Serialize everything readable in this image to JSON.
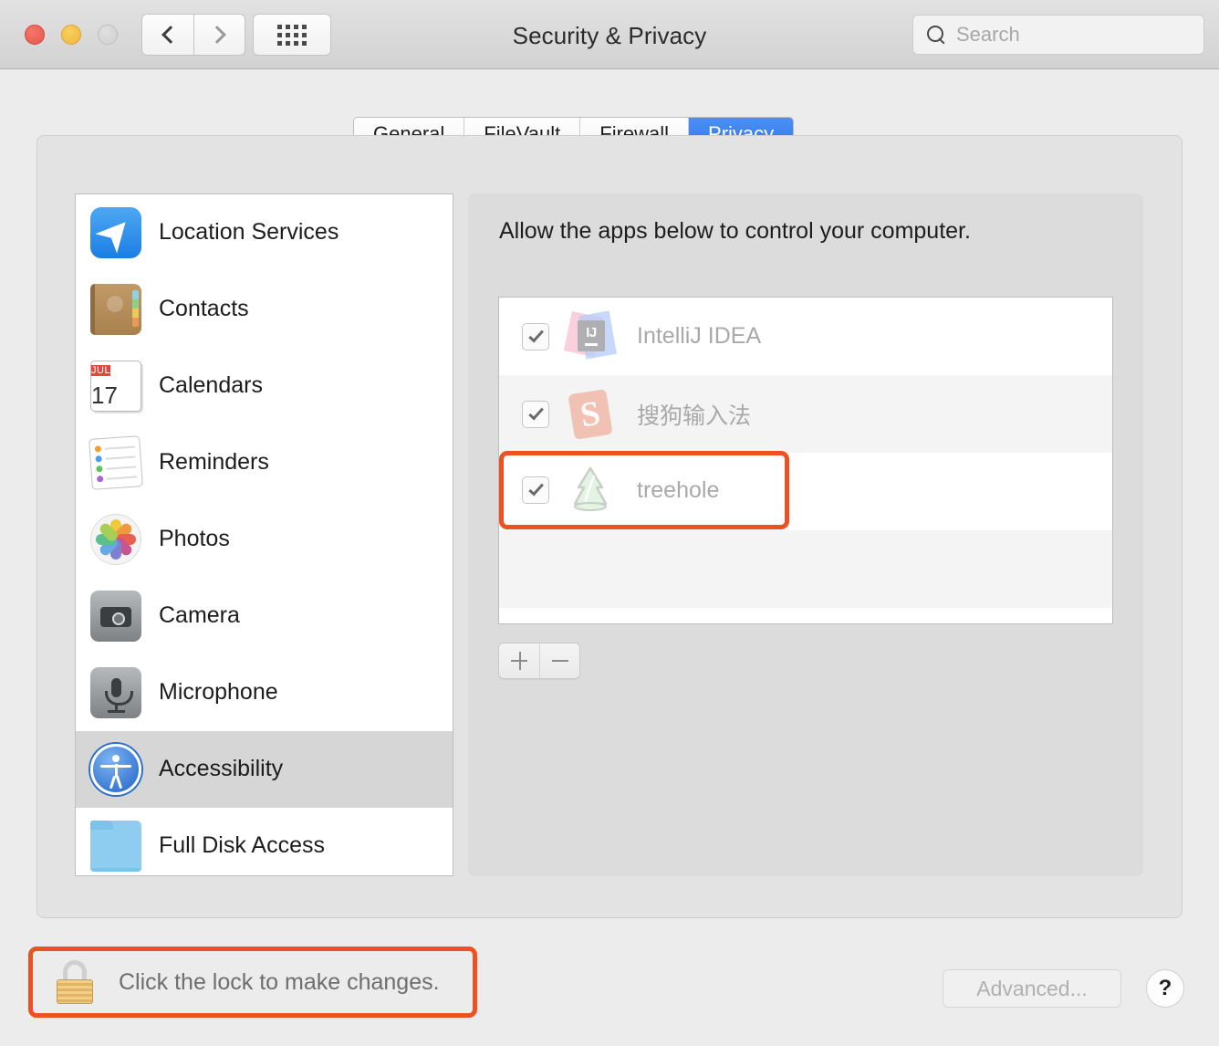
{
  "window": {
    "title": "Security & Privacy",
    "traffic_lights": [
      "close",
      "minimize",
      "zoom"
    ]
  },
  "toolbar": {
    "back_icon": "chevron-left-icon",
    "forward_icon": "chevron-right-icon",
    "show_all_icon": "grid-icon",
    "search": {
      "placeholder": "Search",
      "value": "",
      "icon": "search-icon"
    }
  },
  "tabs": [
    {
      "label": "General",
      "active": false
    },
    {
      "label": "FileVault",
      "active": false
    },
    {
      "label": "Firewall",
      "active": false
    },
    {
      "label": "Privacy",
      "active": true
    }
  ],
  "sidebar": {
    "items": [
      {
        "label": "Location Services",
        "icon": "location-services-icon",
        "selected": false
      },
      {
        "label": "Contacts",
        "icon": "contacts-icon",
        "selected": false
      },
      {
        "label": "Calendars",
        "icon": "calendar-icon",
        "selected": false,
        "calendar_month": "JUL",
        "calendar_day": "17"
      },
      {
        "label": "Reminders",
        "icon": "reminders-icon",
        "selected": false
      },
      {
        "label": "Photos",
        "icon": "photos-icon",
        "selected": false
      },
      {
        "label": "Camera",
        "icon": "camera-icon",
        "selected": false
      },
      {
        "label": "Microphone",
        "icon": "microphone-icon",
        "selected": false
      },
      {
        "label": "Accessibility",
        "icon": "accessibility-icon",
        "selected": true
      },
      {
        "label": "Full Disk Access",
        "icon": "folder-icon",
        "selected": false
      }
    ]
  },
  "main": {
    "description": "Allow the apps below to control your computer.",
    "apps": [
      {
        "name": "IntelliJ IDEA",
        "icon": "intellij-idea-icon",
        "checked": true,
        "highlighted": false
      },
      {
        "name": "搜狗输入法",
        "icon": "sogou-input-icon",
        "checked": true,
        "highlighted": false
      },
      {
        "name": "treehole",
        "icon": "treehole-icon",
        "checked": true,
        "highlighted": true
      }
    ],
    "add_button": "+",
    "remove_button": "−"
  },
  "footer": {
    "lock_text": "Click the lock to make changes.",
    "lock_icon": "lock-closed-icon",
    "advanced_label": "Advanced...",
    "help_label": "?"
  },
  "colors": {
    "accent_tab": "#2f77ef",
    "highlight_ring": "#ec5221",
    "window_bg": "#ececec",
    "panel_bg": "#dcdcdc",
    "selected_row": "#d6d6d6"
  }
}
